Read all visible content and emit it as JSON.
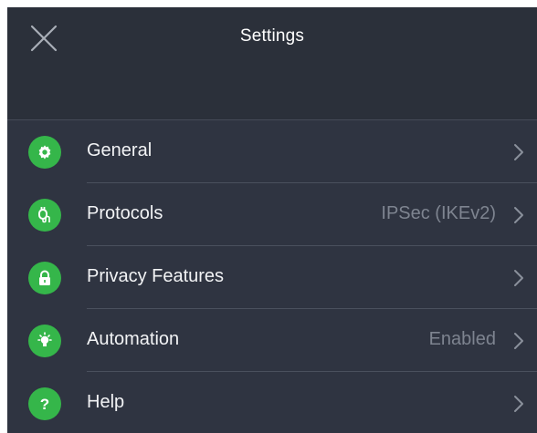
{
  "header": {
    "title": "Settings",
    "close_icon": "close-icon"
  },
  "colors": {
    "background": "#2f3441",
    "header_background": "#2b303a",
    "accent_green": "#35b64a",
    "label_text": "#f2f3f5",
    "value_text": "#7e8490"
  },
  "items": [
    {
      "label": "General",
      "value": "",
      "icon": "gear-icon"
    },
    {
      "label": "Protocols",
      "value": "IPSec (IKEv2)",
      "icon": "protocol-plug-icon"
    },
    {
      "label": "Privacy Features",
      "value": "",
      "icon": "lock-icon"
    },
    {
      "label": "Automation",
      "value": "Enabled",
      "icon": "lightbulb-icon"
    },
    {
      "label": "Help",
      "value": "",
      "icon": "question-icon"
    }
  ]
}
